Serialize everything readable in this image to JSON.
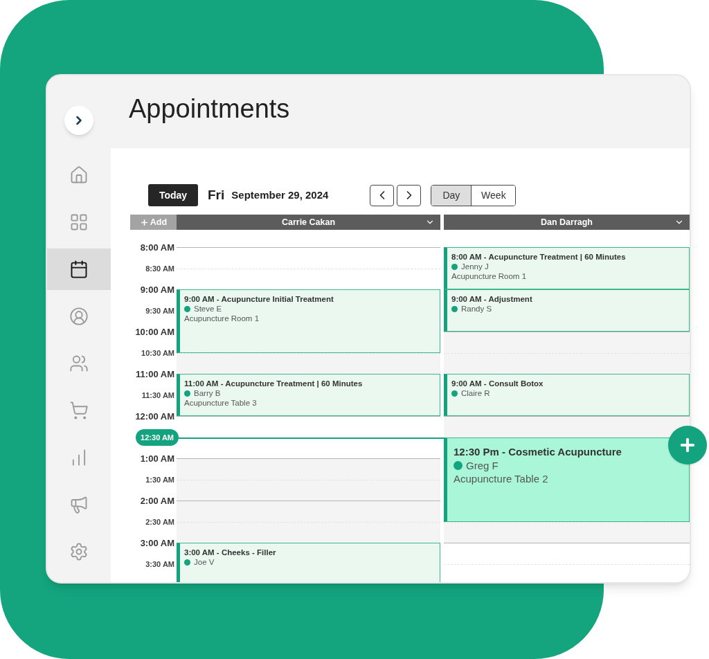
{
  "header": {
    "title": "Appointments"
  },
  "sidebar": {
    "items": [
      {
        "selected": false
      },
      {
        "selected": false
      },
      {
        "selected": true
      },
      {
        "selected": false
      },
      {
        "selected": false
      },
      {
        "selected": false
      },
      {
        "selected": false
      },
      {
        "selected": false
      },
      {
        "selected": false
      }
    ]
  },
  "toolbar": {
    "today": "Today",
    "weekday": "Fri",
    "date": "September 29, 2024",
    "views": [
      {
        "label": "Day",
        "selected": true
      },
      {
        "label": "Week",
        "selected": false
      }
    ]
  },
  "add_button": "Add",
  "times": [
    {
      "label": "8:00 AM",
      "kind": "hour"
    },
    {
      "label": "8:30 AM",
      "kind": "half"
    },
    {
      "label": "9:00 AM",
      "kind": "hour"
    },
    {
      "label": "9:30 AM",
      "kind": "half"
    },
    {
      "label": "10:00 AM",
      "kind": "hour"
    },
    {
      "label": "10:30 AM",
      "kind": "half"
    },
    {
      "label": "11:00 AM",
      "kind": "hour"
    },
    {
      "label": "11:30 AM",
      "kind": "half"
    },
    {
      "label": "12:00 AM",
      "kind": "hour"
    },
    {
      "label": "12:30 AM",
      "kind": "now"
    },
    {
      "label": "1:00 AM",
      "kind": "hour"
    },
    {
      "label": "1:30 AM",
      "kind": "half"
    },
    {
      "label": "2:00 AM",
      "kind": "hour"
    },
    {
      "label": "2:30 AM",
      "kind": "half"
    },
    {
      "label": "3:00 AM",
      "kind": "hour"
    },
    {
      "label": "3:30 AM",
      "kind": "half"
    }
  ],
  "columns": [
    {
      "name": "Carrie Cakan",
      "events": [
        {
          "title": "9:00 AM - Acupuncture Initial Treatment",
          "client": "Steve E",
          "room": "Acupuncture Room 1",
          "highlighted": false
        },
        {
          "title": "11:00 AM - Acupuncture Treatment | 60 Minutes",
          "client": "Barry B",
          "room": "Acupuncture Table 3",
          "highlighted": false
        },
        {
          "title": "3:00 AM - Cheeks - Filler",
          "client": "Joe V",
          "highlighted": false
        }
      ]
    },
    {
      "name": "Dan Darragh",
      "events": [
        {
          "title": "8:00 AM - Acupuncture Treatment | 60 Minutes",
          "client": "Jenny J",
          "room": "Acupuncture Room 1",
          "highlighted": false
        },
        {
          "title": "9:00 AM - Adjustment",
          "client": "Randy S",
          "highlighted": false
        },
        {
          "title": "9:00 AM - Consult Botox",
          "client": "Claire R",
          "highlighted": false
        },
        {
          "title": "12:30 Pm - Cosmetic Acupuncture",
          "client": "Greg F",
          "room": "Acupuncture Table 2",
          "highlighted": true
        }
      ]
    }
  ]
}
